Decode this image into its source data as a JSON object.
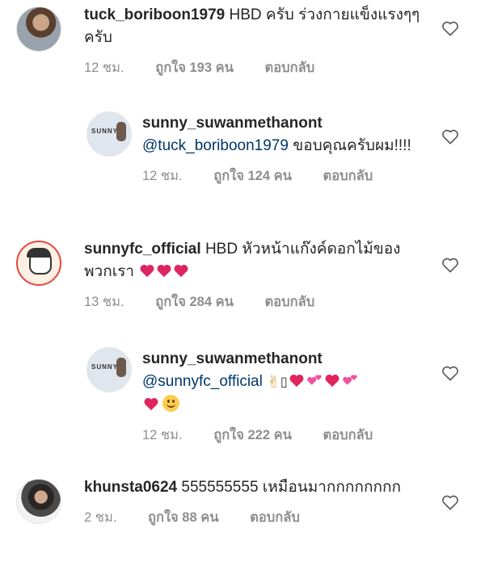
{
  "comments": [
    {
      "username": "tuck_boriboon1979",
      "text": "HBD ครับ ร่วงกายแข็งแรงๆๆครับ",
      "time": "12 ชม.",
      "likes": "ถูกใจ 193 คน",
      "reply": "ตอบกลับ"
    },
    {
      "username": "sunny_suwanmethanont",
      "mention": "@tuck_boriboon1979",
      "text": "ขอบคุณครับผม!!!!",
      "time": "12 ชม.",
      "likes": "ถูกใจ 124 คน",
      "reply": "ตอบกลับ"
    },
    {
      "username": "sunnyfc_official",
      "text": "HBD หัวหน้าแก๊งค์ดอกไม้ของพวกเรา",
      "time": "13 ชม.",
      "likes": "ถูกใจ 284 คน",
      "reply": "ตอบกลับ"
    },
    {
      "username": "sunny_suwanmethanont",
      "mention": "@sunnyfc_official",
      "box_glyph": "▯",
      "time": "12 ชม.",
      "likes": "ถูกใจ 222 คน",
      "reply": "ตอบกลับ"
    },
    {
      "username": "khunsta0624",
      "text": "555555555 เหมือนมากกกกกกกก",
      "time": "2 ชม.",
      "likes": "ถูกใจ 88 คน",
      "reply": "ตอบกลับ"
    }
  ],
  "avatar_label": "SUNNY",
  "colors": {
    "text": "#262626",
    "meta": "#8e8e8e",
    "mention": "#00376b",
    "heart_red": "#e0245e"
  },
  "icons": {
    "like": "heart-outline-icon",
    "emoji_heart": "red-heart-icon"
  }
}
